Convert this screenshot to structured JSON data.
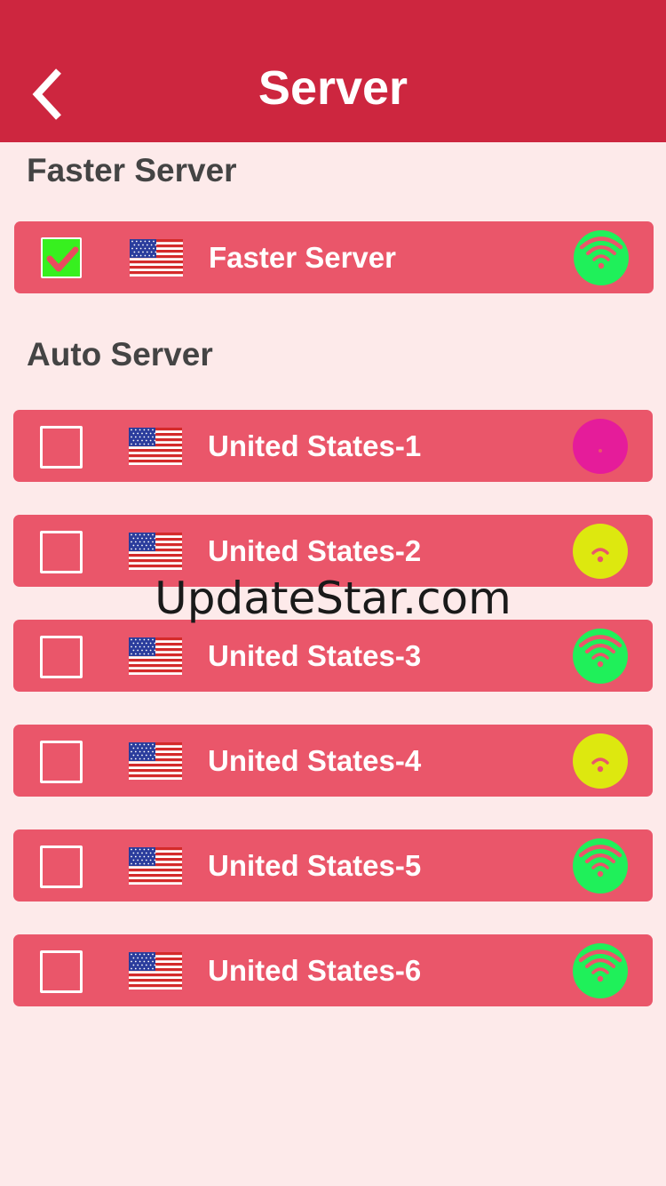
{
  "header": {
    "title": "Server"
  },
  "sections": {
    "faster_title": "Faster Server",
    "auto_title": "Auto Server"
  },
  "faster": {
    "label": "Faster Server",
    "checked": true,
    "signal_level": 3,
    "signal_color": "#1ff05a"
  },
  "servers": [
    {
      "label": "United States-1",
      "checked": false,
      "signal_level": 0,
      "signal_color": "#e51c9a"
    },
    {
      "label": "United States-2",
      "checked": false,
      "signal_level": 1,
      "signal_color": "#dde80f"
    },
    {
      "label": "United States-3",
      "checked": false,
      "signal_level": 3,
      "signal_color": "#1ff05a"
    },
    {
      "label": "United States-4",
      "checked": false,
      "signal_level": 1,
      "signal_color": "#dde80f"
    },
    {
      "label": "United States-5",
      "checked": false,
      "signal_level": 3,
      "signal_color": "#1ff05a"
    },
    {
      "label": "United States-6",
      "checked": false,
      "signal_level": 3,
      "signal_color": "#1ff05a"
    }
  ],
  "icons": {
    "back": "chevron-left-icon",
    "flag": "us-flag-icon",
    "signal": "wifi-signal-icon",
    "check": "checkmark-icon"
  },
  "colors": {
    "header": "#cd263f",
    "row": "#ea566a",
    "background": "#fdeaea",
    "checked_box": "#37f01f"
  },
  "watermark": "UpdateStar.com"
}
